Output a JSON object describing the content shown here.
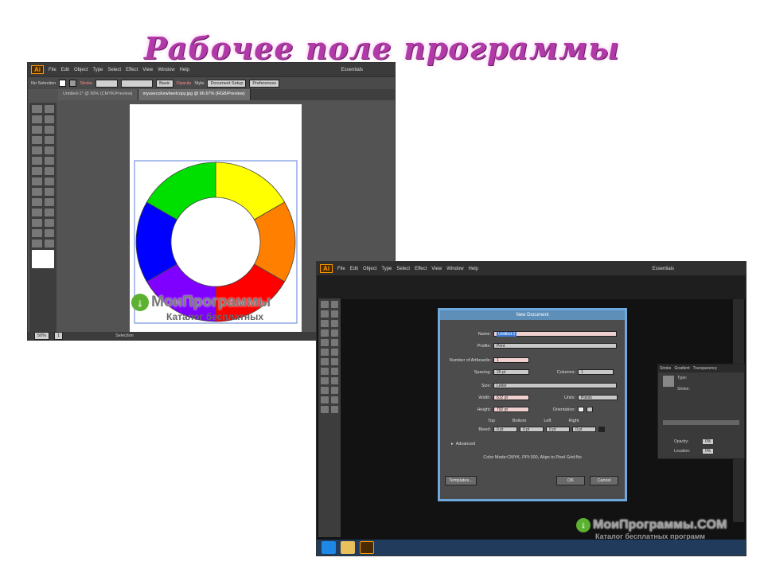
{
  "slide": {
    "title": "Рабочее поле программы"
  },
  "screen1": {
    "app_logo": "Ai",
    "menu": [
      "File",
      "Edit",
      "Object",
      "Type",
      "Select",
      "Effect",
      "View",
      "Window",
      "Help"
    ],
    "workspace": "Essentials",
    "control": {
      "selection": "No Selection",
      "stroke": "Stroke",
      "basic": "Basic",
      "opacity": "Opacity",
      "style": "Style",
      "doc_setup": "Document Setup",
      "preferences": "Preferences"
    },
    "tabs": [
      "Untitled-1* @ 50% (CMYK/Preview)",
      "myusecolorwheelcopy.jpg @ 66.67% (RGB/Preview)"
    ],
    "status": {
      "zoom": "50%",
      "page": "1",
      "mode": "Selection"
    },
    "color_wheel": [
      {
        "color": "#ffff00"
      },
      {
        "color": "#ff8000"
      },
      {
        "color": "#ff0000"
      },
      {
        "color": "#8000ff"
      },
      {
        "color": "#0000ff"
      },
      {
        "color": "#00e000"
      }
    ],
    "watermark": {
      "name": "МоиПрограммы",
      "tagline": "Каталог бесплатных"
    }
  },
  "screen2": {
    "app_logo": "Ai",
    "menu": [
      "File",
      "Edit",
      "Object",
      "Type",
      "Select",
      "Effect",
      "View",
      "Window",
      "Help"
    ],
    "workspace": "Essentials",
    "dialog": {
      "title": "New Document",
      "name_label": "Name:",
      "name_value": "Untitled-1",
      "profile_label": "Profile:",
      "profile_value": "Print",
      "artboards_label": "Number of Artboards:",
      "artboards_value": "1",
      "spacing_label": "Spacing:",
      "spacing_value": "20 pt",
      "columns_label": "Columns:",
      "columns_value": "1",
      "size_label": "Size:",
      "size_value": "Letter",
      "width_label": "Width:",
      "width_value": "612 pt",
      "units_label": "Units:",
      "units_value": "Points",
      "height_label": "Height:",
      "height_value": "792 pt",
      "orientation_label": "Orientation:",
      "top_label": "Top",
      "bottom_label": "Bottom",
      "left_label": "Left",
      "right_label": "Right",
      "bleed_label": "Bleed:",
      "bleed_top": "0 pt",
      "bleed_bottom": "0 pt",
      "bleed_left": "0 pt",
      "bleed_right": "0 pt",
      "advanced_label": "Advanced",
      "info": "Color Mode:CMYK, PPI:300, Align to Pixel Grid:No",
      "templates_button": "Templates...",
      "ok_button": "OK",
      "cancel_button": "Cancel"
    },
    "panel": {
      "tabs": [
        "Stroke",
        "Gradient",
        "Transparency"
      ],
      "type_label": "Type:",
      "stroke_label": "Stroke:",
      "opacity_label": "Opacity:",
      "opacity_value": "0%",
      "location_label": "Location:",
      "location_value": "0%"
    },
    "watermark": {
      "name": "МоиПрограммы.COM",
      "tagline": "Каталог бесплатных программ"
    }
  }
}
